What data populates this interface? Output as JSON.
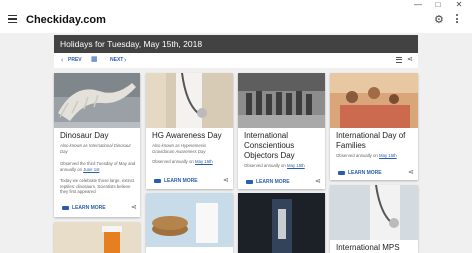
{
  "window": {
    "minimize": "—",
    "maximize": "□",
    "close": "✕"
  },
  "appbar": {
    "brand": "Checkiday.com",
    "menu_icon": "hamburger-icon",
    "settings_icon": "gear-icon",
    "more_icon": "more-vert-icon"
  },
  "header": {
    "title": "Holidays for Tuesday, May 15th, 2018",
    "prev_label": "PREV",
    "next_label": "NEXT",
    "calendar_icon": "calendar-icon",
    "list_icon": "list-icon",
    "share_icon": "share-icon"
  },
  "cards": [
    {
      "title": "Dinosaur Day",
      "aka": "Also known as International Dinosaur Day",
      "observed_prefix": "Observed the third Tuesday of May and annually on",
      "observed_link": "June 1st",
      "description": "Today we celebrate those large, extinct reptiles: dinosaurs. Scientists believe they first appeared",
      "learn_more": "LEARN MORE",
      "image_color": "#8a8f93"
    },
    {
      "title": "HG Awareness Day",
      "aka": "Also known as Hyperemesis Gravidarum Awareness Day",
      "observed_prefix": "Observed annually on",
      "observed_link": "May 15th",
      "learn_more": "LEARN MORE",
      "image_color": "#c9b89f"
    },
    {
      "title": "International Conscientious Objectors Day",
      "observed_prefix": "Observed annually on",
      "observed_link": "May 15th",
      "learn_more": "LEARN MORE",
      "image_color": "#7b7b7b"
    },
    {
      "title": "International Day of Families",
      "observed_prefix": "Observed annually on",
      "observed_link": "May 15th",
      "learn_more": "LEARN MORE",
      "image_color": "#c98f5c"
    },
    {
      "title": "",
      "image_color": "#d8c7a8"
    },
    {
      "title": "",
      "image_color": "#c7dbe8"
    },
    {
      "title": "",
      "image_color": "#1c2027"
    },
    {
      "title": "International MPS",
      "image_color": "#b7c4cc"
    }
  ]
}
